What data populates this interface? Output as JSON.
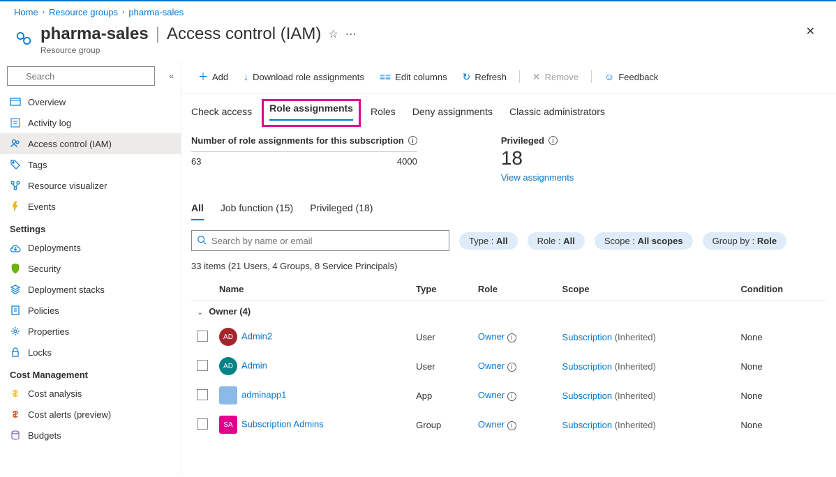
{
  "breadcrumb": [
    "Home",
    "Resource groups",
    "pharma-sales"
  ],
  "header": {
    "title": "pharma-sales",
    "subtitle": "Access control (IAM)",
    "resource_type": "Resource group"
  },
  "sidebar": {
    "search_placeholder": "Search",
    "items": [
      {
        "icon": "overview",
        "label": "Overview"
      },
      {
        "icon": "activity",
        "label": "Activity log"
      },
      {
        "icon": "iam",
        "label": "Access control (IAM)",
        "active": true
      },
      {
        "icon": "tags",
        "label": "Tags"
      },
      {
        "icon": "visualizer",
        "label": "Resource visualizer"
      },
      {
        "icon": "events",
        "label": "Events"
      }
    ],
    "groups": [
      {
        "name": "Settings",
        "items": [
          {
            "icon": "deploy",
            "label": "Deployments"
          },
          {
            "icon": "security",
            "label": "Security"
          },
          {
            "icon": "stacks",
            "label": "Deployment stacks"
          },
          {
            "icon": "policies",
            "label": "Policies"
          },
          {
            "icon": "properties",
            "label": "Properties"
          },
          {
            "icon": "locks",
            "label": "Locks"
          }
        ]
      },
      {
        "name": "Cost Management",
        "items": [
          {
            "icon": "cost",
            "label": "Cost analysis"
          },
          {
            "icon": "alerts",
            "label": "Cost alerts (preview)"
          },
          {
            "icon": "budgets",
            "label": "Budgets"
          }
        ]
      }
    ]
  },
  "commands": {
    "add": "Add",
    "download": "Download role assignments",
    "edit_columns": "Edit columns",
    "refresh": "Refresh",
    "remove": "Remove",
    "feedback": "Feedback"
  },
  "tabs": [
    "Check access",
    "Role assignments",
    "Roles",
    "Deny assignments",
    "Classic administrators"
  ],
  "active_tab": 1,
  "stats": {
    "label": "Number of role assignments for this subscription",
    "current": "63",
    "max": "4000",
    "priv_label": "Privileged",
    "priv_count": "18",
    "priv_link": "View assignments"
  },
  "subtabs": [
    {
      "label": "All",
      "active": true
    },
    {
      "label": "Job function (15)"
    },
    {
      "label": "Privileged (18)"
    }
  ],
  "filters": {
    "search_placeholder": "Search by name or email",
    "type": {
      "label": "Type : ",
      "value": "All"
    },
    "role": {
      "label": "Role : ",
      "value": "All"
    },
    "scope": {
      "label": "Scope : ",
      "value": "All scopes"
    },
    "groupby": {
      "label": "Group by : ",
      "value": "Role"
    }
  },
  "summary": "33 items (21 Users, 4 Groups, 8 Service Principals)",
  "columns": [
    "Name",
    "Type",
    "Role",
    "Scope",
    "Condition"
  ],
  "group_header": "Owner (4)",
  "rows": [
    {
      "avatar": "AD",
      "color": "#a4262c",
      "name": "Admin2",
      "type": "User",
      "role": "Owner",
      "scope": "Subscription",
      "inherited": "(Inherited)",
      "condition": "None"
    },
    {
      "avatar": "AD",
      "color": "#038387",
      "name": "Admin",
      "type": "User",
      "role": "Owner",
      "scope": "Subscription",
      "inherited": "(Inherited)",
      "condition": "None"
    },
    {
      "avatar": "",
      "color": "#8cbae8",
      "square": true,
      "name": "adminapp1",
      "type": "App",
      "role": "Owner",
      "scope": "Subscription",
      "inherited": "(Inherited)",
      "condition": "None"
    },
    {
      "avatar": "SA",
      "color": "#e3008c",
      "square": true,
      "name": "Subscription Admins",
      "type": "Group",
      "role": "Owner",
      "scope": "Subscription",
      "inherited": "(Inherited)",
      "condition": "None"
    }
  ]
}
